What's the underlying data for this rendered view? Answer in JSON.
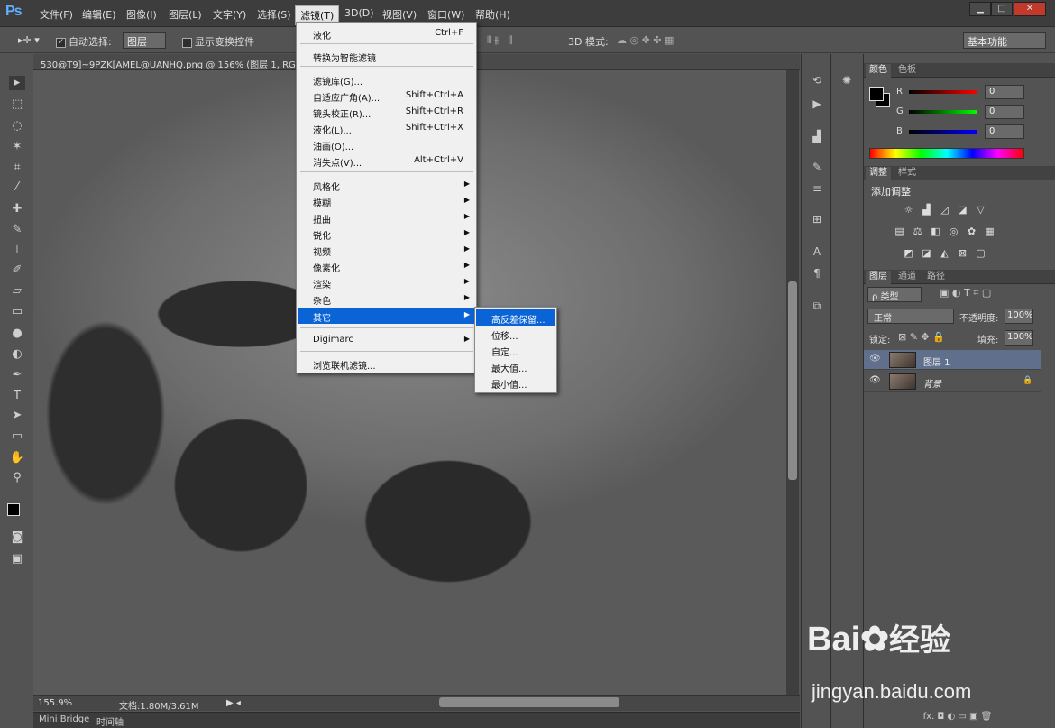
{
  "app": {
    "logo": "Ps"
  },
  "menubar": {
    "items": [
      "文件(F)",
      "编辑(E)",
      "图像(I)",
      "图层(L)",
      "文字(Y)",
      "选择(S)",
      "滤镜(T)",
      "3D(D)",
      "视图(V)",
      "窗口(W)",
      "帮助(H)"
    ],
    "active": "滤镜(T)"
  },
  "window_controls": {
    "minimize": "▁",
    "restore": "□",
    "close": "✕"
  },
  "options": {
    "auto_select_label": "自动选择:",
    "auto_select_value": "图层",
    "show_transform_label": "显示变换控件",
    "mode_3d_label": "3D 模式:",
    "workspace": "基本功能"
  },
  "document": {
    "tab_title": "530@T9]~9PZK[AMEL@UANHQ.png @ 156% (图层 1, RGB/8)",
    "zoom": "155.9%",
    "doc_size": "文档:1.80M/3.61M"
  },
  "bottom_tabs": [
    "Mini Bridge",
    "时间轴"
  ],
  "filter_menu": {
    "items": [
      {
        "label": "液化",
        "shortcut": "Ctrl+F"
      },
      {
        "label": "转换为智能滤镜",
        "shortcut": ""
      },
      {
        "label": "滤镜库(G)...",
        "shortcut": ""
      },
      {
        "label": "自适应广角(A)...",
        "shortcut": "Shift+Ctrl+A"
      },
      {
        "label": "镜头校正(R)...",
        "shortcut": "Shift+Ctrl+R"
      },
      {
        "label": "液化(L)...",
        "shortcut": "Shift+Ctrl+X"
      },
      {
        "label": "油画(O)...",
        "shortcut": ""
      },
      {
        "label": "消失点(V)...",
        "shortcut": "Alt+Ctrl+V"
      },
      {
        "label": "风格化",
        "shortcut": ""
      },
      {
        "label": "模糊",
        "shortcut": ""
      },
      {
        "label": "扭曲",
        "shortcut": ""
      },
      {
        "label": "锐化",
        "shortcut": ""
      },
      {
        "label": "视频",
        "shortcut": ""
      },
      {
        "label": "像素化",
        "shortcut": ""
      },
      {
        "label": "渲染",
        "shortcut": ""
      },
      {
        "label": "杂色",
        "shortcut": ""
      },
      {
        "label": "其它",
        "shortcut": ""
      },
      {
        "label": "Digimarc",
        "shortcut": ""
      },
      {
        "label": "浏览联机滤镜...",
        "shortcut": ""
      }
    ],
    "highlighted": "其它"
  },
  "other_submenu": {
    "items": [
      "高反差保留...",
      "位移...",
      "自定...",
      "最大值...",
      "最小值..."
    ],
    "highlighted": "高反差保留..."
  },
  "color_panel": {
    "tabs": [
      "颜色",
      "色板"
    ],
    "r_label": "R",
    "g_label": "G",
    "b_label": "B",
    "r": "0",
    "g": "0",
    "b": "0"
  },
  "adjust_panel": {
    "tabs": [
      "调整",
      "样式"
    ],
    "title": "添加调整"
  },
  "layers_panel": {
    "tabs": [
      "图层",
      "通道",
      "路径"
    ],
    "kind_filter": "ρ 类型",
    "blend_mode": "正常",
    "opacity_label": "不透明度:",
    "opacity": "100%",
    "lock_label": "锁定:",
    "fill_label": "填充:",
    "fill": "100%",
    "layers": [
      {
        "name": "图层 1",
        "selected": true
      },
      {
        "name": "背景",
        "selected": false
      }
    ],
    "footer_label": "fx."
  },
  "watermark": {
    "brand": "Bai",
    "brand2": "经验",
    "url": "jingyan.baidu.com"
  }
}
